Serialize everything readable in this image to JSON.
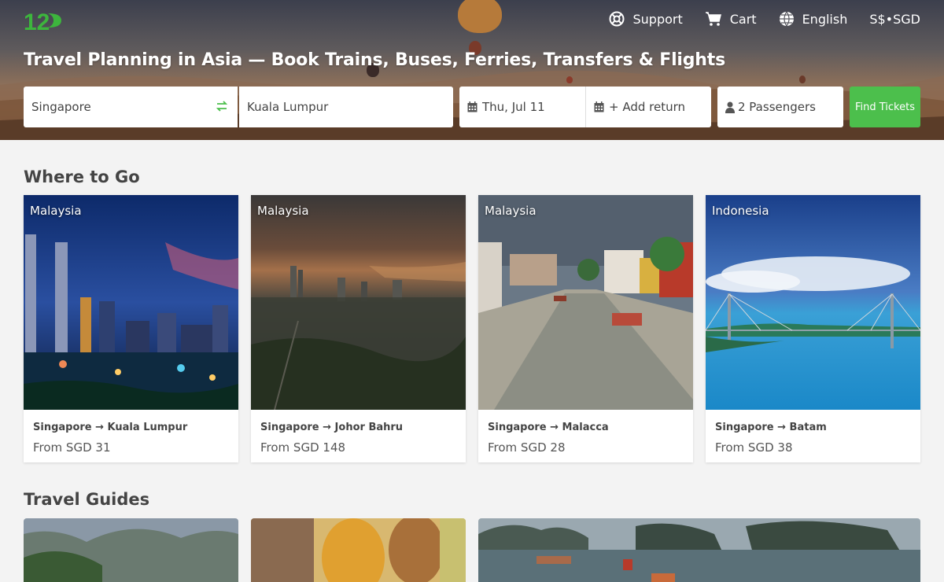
{
  "header": {
    "nav": [
      {
        "label": "Support",
        "icon": "support-icon"
      },
      {
        "label": "Cart",
        "icon": "cart-icon"
      },
      {
        "label": "English",
        "icon": "globe-icon"
      },
      {
        "label": "S$•SGD",
        "icon": ""
      }
    ],
    "title": "Travel Planning in Asia — Book Trains, Buses, Ferries, Transfers & Flights"
  },
  "search": {
    "from": "Singapore",
    "to": "Kuala Lumpur",
    "date": "Thu, Jul 11",
    "return": "+ Add return",
    "passengers": "2 Passengers",
    "button": "Find Tickets"
  },
  "where_to_go": {
    "title": "Where to Go",
    "cards": [
      {
        "country": "Malaysia",
        "route": "Singapore → Kuala Lumpur",
        "price": "From SGD 31"
      },
      {
        "country": "Malaysia",
        "route": "Singapore → Johor Bahru",
        "price": "From SGD 148"
      },
      {
        "country": "Malaysia",
        "route": "Singapore → Malacca",
        "price": "From SGD 28"
      },
      {
        "country": "Indonesia",
        "route": "Singapore → Batam",
        "price": "From SGD 38"
      }
    ]
  },
  "travel_guides": {
    "title": "Travel Guides"
  },
  "colors": {
    "accent": "#4cbf4c",
    "brand_logo": "#3db53d"
  }
}
